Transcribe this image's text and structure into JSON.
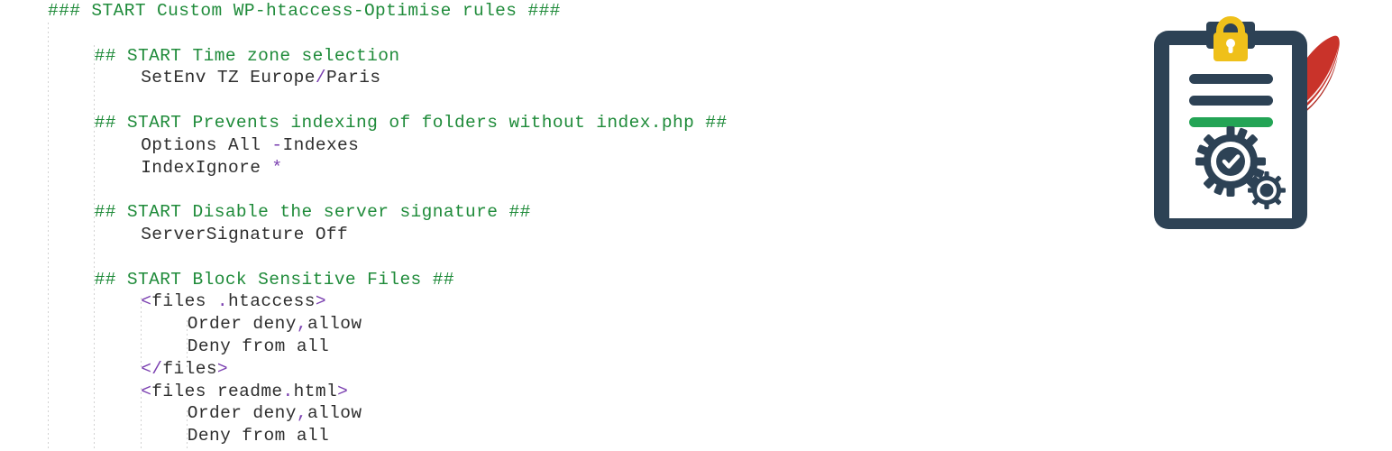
{
  "editor": {
    "language": "apache-htaccess",
    "background_color": "#ffffff",
    "comment_color": "#1f8b3a",
    "punctuation_color": "#7a3fb0",
    "text_color": "#2e2e2e",
    "lines": [
      {
        "indent": 0,
        "tokens": [
          {
            "t": "comment",
            "v": "### START Custom WP-htaccess-Optimise rules ###"
          }
        ]
      },
      {
        "indent": 0,
        "tokens": [
          {
            "t": "plain",
            "v": ""
          }
        ]
      },
      {
        "indent": 1,
        "tokens": [
          {
            "t": "comment",
            "v": "## START Time zone selection"
          }
        ]
      },
      {
        "indent": 2,
        "tokens": [
          {
            "t": "plain",
            "v": "SetEnv TZ Europe"
          },
          {
            "t": "punct",
            "v": "/"
          },
          {
            "t": "plain",
            "v": "Paris"
          }
        ]
      },
      {
        "indent": 0,
        "tokens": [
          {
            "t": "plain",
            "v": ""
          }
        ]
      },
      {
        "indent": 1,
        "tokens": [
          {
            "t": "comment",
            "v": "## START Prevents indexing of folders without index.php ##"
          }
        ]
      },
      {
        "indent": 2,
        "tokens": [
          {
            "t": "plain",
            "v": "Options All "
          },
          {
            "t": "punct",
            "v": "-"
          },
          {
            "t": "plain",
            "v": "Indexes"
          }
        ]
      },
      {
        "indent": 2,
        "tokens": [
          {
            "t": "plain",
            "v": "IndexIgnore "
          },
          {
            "t": "punct",
            "v": "*"
          }
        ]
      },
      {
        "indent": 0,
        "tokens": [
          {
            "t": "plain",
            "v": ""
          }
        ]
      },
      {
        "indent": 1,
        "tokens": [
          {
            "t": "comment",
            "v": "## START Disable the server signature ##"
          }
        ]
      },
      {
        "indent": 2,
        "tokens": [
          {
            "t": "plain",
            "v": "ServerSignature Off"
          }
        ]
      },
      {
        "indent": 0,
        "tokens": [
          {
            "t": "plain",
            "v": ""
          }
        ]
      },
      {
        "indent": 1,
        "tokens": [
          {
            "t": "comment",
            "v": "## START Block Sensitive Files ##"
          }
        ]
      },
      {
        "indent": 2,
        "tokens": [
          {
            "t": "punct",
            "v": "<"
          },
          {
            "t": "plain",
            "v": "files "
          },
          {
            "t": "punct",
            "v": "."
          },
          {
            "t": "plain",
            "v": "htaccess"
          },
          {
            "t": "punct",
            "v": ">"
          }
        ]
      },
      {
        "indent": 3,
        "tokens": [
          {
            "t": "plain",
            "v": "Order deny"
          },
          {
            "t": "punct",
            "v": ","
          },
          {
            "t": "plain",
            "v": "allow"
          }
        ]
      },
      {
        "indent": 3,
        "tokens": [
          {
            "t": "plain",
            "v": "Deny from all"
          }
        ]
      },
      {
        "indent": 2,
        "tokens": [
          {
            "t": "punct",
            "v": "</"
          },
          {
            "t": "plain",
            "v": "files"
          },
          {
            "t": "punct",
            "v": ">"
          }
        ]
      },
      {
        "indent": 2,
        "tokens": [
          {
            "t": "punct",
            "v": "<"
          },
          {
            "t": "plain",
            "v": "files readme"
          },
          {
            "t": "punct",
            "v": "."
          },
          {
            "t": "plain",
            "v": "html"
          },
          {
            "t": "punct",
            "v": ">"
          }
        ]
      },
      {
        "indent": 3,
        "tokens": [
          {
            "t": "plain",
            "v": "Order deny"
          },
          {
            "t": "punct",
            "v": ","
          },
          {
            "t": "plain",
            "v": "allow"
          }
        ]
      },
      {
        "indent": 3,
        "tokens": [
          {
            "t": "plain",
            "v": "Deny from all"
          }
        ]
      }
    ]
  },
  "illustration": {
    "name": "secured-htaccess-clipboard-with-quill",
    "parts": {
      "clipboard_body": "clipboard-board",
      "padlock": "padlock-icon",
      "paper": "document-page",
      "text_lines": [
        "line-1",
        "line-2",
        "line-3-highlighted"
      ],
      "gears": [
        "large-gear-with-check",
        "small-gear"
      ],
      "quill": "red-feather-quill"
    },
    "colors": {
      "clipboard_navy": "#2d4255",
      "paper_white": "#ffffff",
      "padlock_gold": "#efc01a",
      "line_navy": "#2d4255",
      "line_green": "#23a455",
      "quill_red": "#c9332a",
      "quill_red_dark": "#b02a22"
    }
  }
}
